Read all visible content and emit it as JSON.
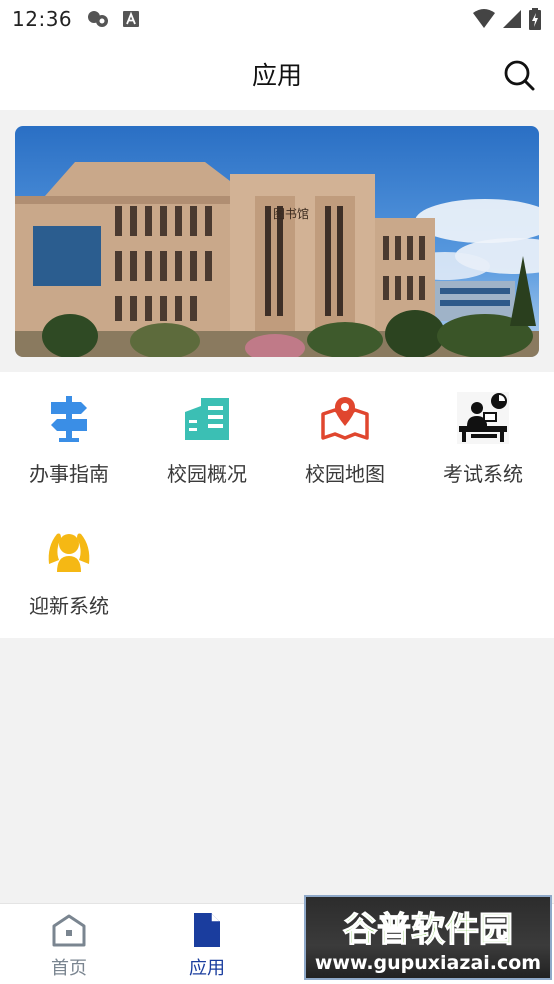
{
  "status_bar": {
    "time": "12:36"
  },
  "header": {
    "title": "应用"
  },
  "banner": {
    "building_sign": "图书馆"
  },
  "apps": [
    {
      "label": "办事指南",
      "icon": "signpost-icon"
    },
    {
      "label": "校园概况",
      "icon": "building-icon"
    },
    {
      "label": "校园地图",
      "icon": "map-pin-icon"
    },
    {
      "label": "考试系统",
      "icon": "exam-desk-icon"
    },
    {
      "label": "迎新系统",
      "icon": "welcome-person-icon"
    }
  ],
  "bottom_nav": {
    "items": [
      {
        "label": "首页",
        "icon": "home-icon",
        "active": false
      },
      {
        "label": "应用",
        "icon": "document-icon",
        "active": true
      }
    ]
  },
  "watermark": {
    "title": "谷普软件园",
    "url": "www.gupuxiazai.com"
  },
  "colors": {
    "active_nav": "#1a3d9e",
    "signpost_icon": "#3a8ee6",
    "building_icon": "#3bbfb4",
    "map_icon": "#e0462e",
    "welcome_icon": "#f5b814"
  }
}
